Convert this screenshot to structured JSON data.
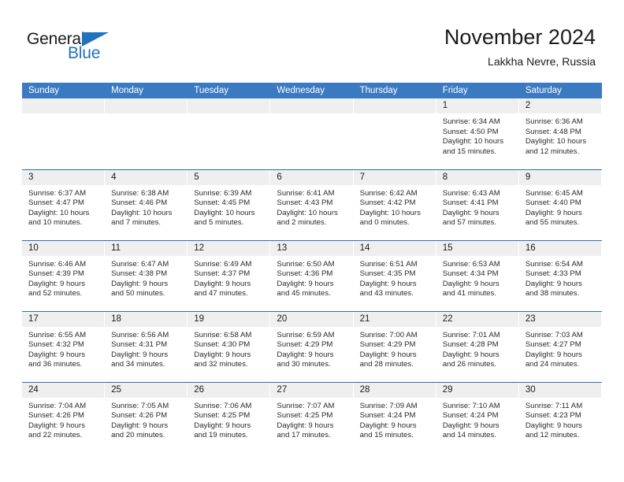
{
  "brand": {
    "name_part1": "General",
    "name_part2": "Blue",
    "triangle_icon": "triangle-icon",
    "accent_color": "#1f72bd"
  },
  "header": {
    "title": "November 2024",
    "location": "Lakkha Nevre, Russia"
  },
  "calendar": {
    "header_bg": "#3b7ac0",
    "daynum_bg": "#efefef",
    "row_divider": "#2e6db4",
    "weekdays": [
      "Sunday",
      "Monday",
      "Tuesday",
      "Wednesday",
      "Thursday",
      "Friday",
      "Saturday"
    ],
    "weeks": [
      [
        {
          "day": "",
          "empty": true
        },
        {
          "day": "",
          "empty": true
        },
        {
          "day": "",
          "empty": true
        },
        {
          "day": "",
          "empty": true
        },
        {
          "day": "",
          "empty": true
        },
        {
          "day": "1",
          "sunrise": "Sunrise: 6:34 AM",
          "sunset": "Sunset: 4:50 PM",
          "daylight1": "Daylight: 10 hours",
          "daylight2": "and 15 minutes."
        },
        {
          "day": "2",
          "sunrise": "Sunrise: 6:36 AM",
          "sunset": "Sunset: 4:48 PM",
          "daylight1": "Daylight: 10 hours",
          "daylight2": "and 12 minutes."
        }
      ],
      [
        {
          "day": "3",
          "sunrise": "Sunrise: 6:37 AM",
          "sunset": "Sunset: 4:47 PM",
          "daylight1": "Daylight: 10 hours",
          "daylight2": "and 10 minutes."
        },
        {
          "day": "4",
          "sunrise": "Sunrise: 6:38 AM",
          "sunset": "Sunset: 4:46 PM",
          "daylight1": "Daylight: 10 hours",
          "daylight2": "and 7 minutes."
        },
        {
          "day": "5",
          "sunrise": "Sunrise: 6:39 AM",
          "sunset": "Sunset: 4:45 PM",
          "daylight1": "Daylight: 10 hours",
          "daylight2": "and 5 minutes."
        },
        {
          "day": "6",
          "sunrise": "Sunrise: 6:41 AM",
          "sunset": "Sunset: 4:43 PM",
          "daylight1": "Daylight: 10 hours",
          "daylight2": "and 2 minutes."
        },
        {
          "day": "7",
          "sunrise": "Sunrise: 6:42 AM",
          "sunset": "Sunset: 4:42 PM",
          "daylight1": "Daylight: 10 hours",
          "daylight2": "and 0 minutes."
        },
        {
          "day": "8",
          "sunrise": "Sunrise: 6:43 AM",
          "sunset": "Sunset: 4:41 PM",
          "daylight1": "Daylight: 9 hours",
          "daylight2": "and 57 minutes."
        },
        {
          "day": "9",
          "sunrise": "Sunrise: 6:45 AM",
          "sunset": "Sunset: 4:40 PM",
          "daylight1": "Daylight: 9 hours",
          "daylight2": "and 55 minutes."
        }
      ],
      [
        {
          "day": "10",
          "sunrise": "Sunrise: 6:46 AM",
          "sunset": "Sunset: 4:39 PM",
          "daylight1": "Daylight: 9 hours",
          "daylight2": "and 52 minutes."
        },
        {
          "day": "11",
          "sunrise": "Sunrise: 6:47 AM",
          "sunset": "Sunset: 4:38 PM",
          "daylight1": "Daylight: 9 hours",
          "daylight2": "and 50 minutes."
        },
        {
          "day": "12",
          "sunrise": "Sunrise: 6:49 AM",
          "sunset": "Sunset: 4:37 PM",
          "daylight1": "Daylight: 9 hours",
          "daylight2": "and 47 minutes."
        },
        {
          "day": "13",
          "sunrise": "Sunrise: 6:50 AM",
          "sunset": "Sunset: 4:36 PM",
          "daylight1": "Daylight: 9 hours",
          "daylight2": "and 45 minutes."
        },
        {
          "day": "14",
          "sunrise": "Sunrise: 6:51 AM",
          "sunset": "Sunset: 4:35 PM",
          "daylight1": "Daylight: 9 hours",
          "daylight2": "and 43 minutes."
        },
        {
          "day": "15",
          "sunrise": "Sunrise: 6:53 AM",
          "sunset": "Sunset: 4:34 PM",
          "daylight1": "Daylight: 9 hours",
          "daylight2": "and 41 minutes."
        },
        {
          "day": "16",
          "sunrise": "Sunrise: 6:54 AM",
          "sunset": "Sunset: 4:33 PM",
          "daylight1": "Daylight: 9 hours",
          "daylight2": "and 38 minutes."
        }
      ],
      [
        {
          "day": "17",
          "sunrise": "Sunrise: 6:55 AM",
          "sunset": "Sunset: 4:32 PM",
          "daylight1": "Daylight: 9 hours",
          "daylight2": "and 36 minutes."
        },
        {
          "day": "18",
          "sunrise": "Sunrise: 6:56 AM",
          "sunset": "Sunset: 4:31 PM",
          "daylight1": "Daylight: 9 hours",
          "daylight2": "and 34 minutes."
        },
        {
          "day": "19",
          "sunrise": "Sunrise: 6:58 AM",
          "sunset": "Sunset: 4:30 PM",
          "daylight1": "Daylight: 9 hours",
          "daylight2": "and 32 minutes."
        },
        {
          "day": "20",
          "sunrise": "Sunrise: 6:59 AM",
          "sunset": "Sunset: 4:29 PM",
          "daylight1": "Daylight: 9 hours",
          "daylight2": "and 30 minutes."
        },
        {
          "day": "21",
          "sunrise": "Sunrise: 7:00 AM",
          "sunset": "Sunset: 4:29 PM",
          "daylight1": "Daylight: 9 hours",
          "daylight2": "and 28 minutes."
        },
        {
          "day": "22",
          "sunrise": "Sunrise: 7:01 AM",
          "sunset": "Sunset: 4:28 PM",
          "daylight1": "Daylight: 9 hours",
          "daylight2": "and 26 minutes."
        },
        {
          "day": "23",
          "sunrise": "Sunrise: 7:03 AM",
          "sunset": "Sunset: 4:27 PM",
          "daylight1": "Daylight: 9 hours",
          "daylight2": "and 24 minutes."
        }
      ],
      [
        {
          "day": "24",
          "sunrise": "Sunrise: 7:04 AM",
          "sunset": "Sunset: 4:26 PM",
          "daylight1": "Daylight: 9 hours",
          "daylight2": "and 22 minutes."
        },
        {
          "day": "25",
          "sunrise": "Sunrise: 7:05 AM",
          "sunset": "Sunset: 4:26 PM",
          "daylight1": "Daylight: 9 hours",
          "daylight2": "and 20 minutes."
        },
        {
          "day": "26",
          "sunrise": "Sunrise: 7:06 AM",
          "sunset": "Sunset: 4:25 PM",
          "daylight1": "Daylight: 9 hours",
          "daylight2": "and 19 minutes."
        },
        {
          "day": "27",
          "sunrise": "Sunrise: 7:07 AM",
          "sunset": "Sunset: 4:25 PM",
          "daylight1": "Daylight: 9 hours",
          "daylight2": "and 17 minutes."
        },
        {
          "day": "28",
          "sunrise": "Sunrise: 7:09 AM",
          "sunset": "Sunset: 4:24 PM",
          "daylight1": "Daylight: 9 hours",
          "daylight2": "and 15 minutes."
        },
        {
          "day": "29",
          "sunrise": "Sunrise: 7:10 AM",
          "sunset": "Sunset: 4:24 PM",
          "daylight1": "Daylight: 9 hours",
          "daylight2": "and 14 minutes."
        },
        {
          "day": "30",
          "sunrise": "Sunrise: 7:11 AM",
          "sunset": "Sunset: 4:23 PM",
          "daylight1": "Daylight: 9 hours",
          "daylight2": "and 12 minutes."
        }
      ]
    ]
  }
}
